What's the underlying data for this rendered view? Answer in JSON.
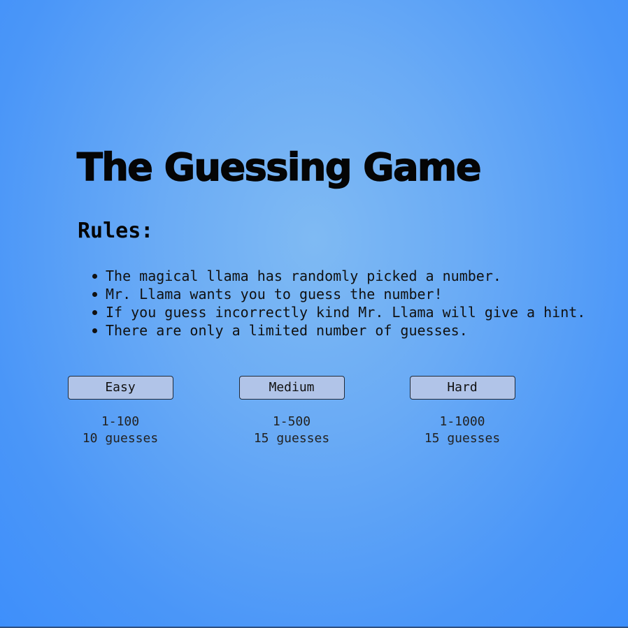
{
  "app": {
    "title": "The Guessing Game"
  },
  "rules": {
    "heading": "Rules:",
    "items": [
      "The magical llama has randomly picked a number.",
      "Mr. Llama wants you to guess the number!",
      "If you guess incorrectly kind Mr. Llama will give a hint.",
      "There are only a limited number of guesses."
    ]
  },
  "modes": [
    {
      "label": "Easy",
      "range": "1-100",
      "guesses": "10 guesses"
    },
    {
      "label": "Medium",
      "range": "1-500",
      "guesses": "15 guesses"
    },
    {
      "label": "Hard",
      "range": "1-1000",
      "guesses": "15 guesses"
    }
  ],
  "colors": {
    "button_bg": "#b1c4e8",
    "background_center": "#7fbaf3",
    "background_edge": "#3e8ffb"
  }
}
